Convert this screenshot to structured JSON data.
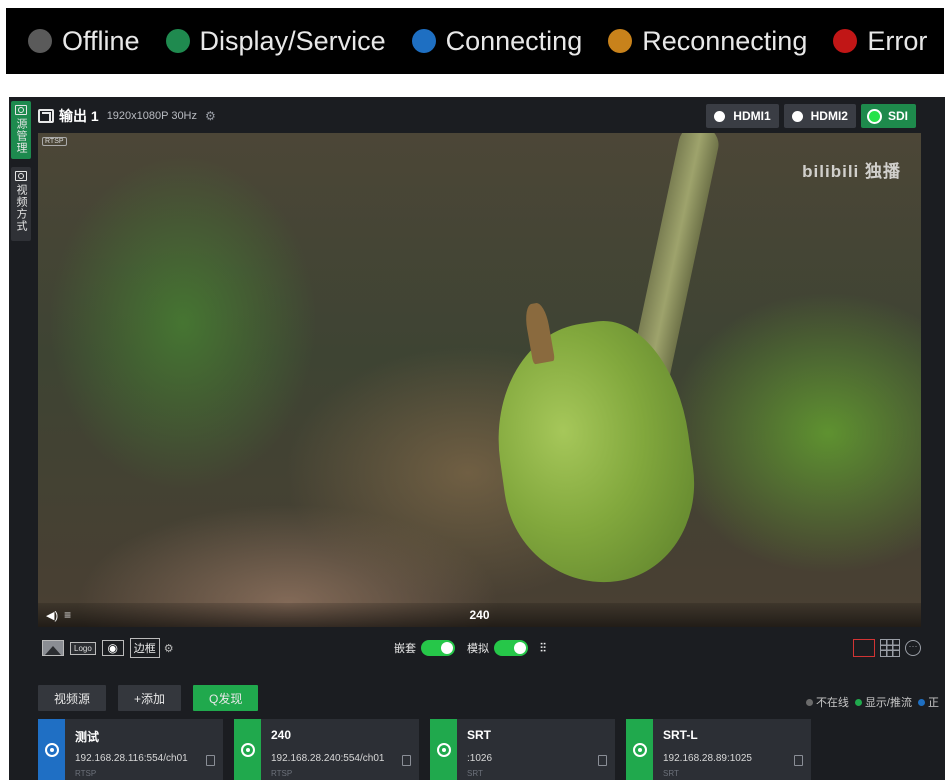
{
  "legend": [
    {
      "label": "Offline",
      "color": "#5a5a5a"
    },
    {
      "label": "Display/Service",
      "color": "#1f8a4f"
    },
    {
      "label": "Connecting",
      "color": "#1e6fc2"
    },
    {
      "label": "Reconnecting",
      "color": "#c8821b"
    },
    {
      "label": "Error",
      "color": "#c11616"
    }
  ],
  "side_tabs": [
    "源管理",
    "视频方式"
  ],
  "output": {
    "title": "输出 1",
    "resolution": "1920x1080P 30Hz",
    "ports": [
      {
        "label": "HDMI1",
        "active": false
      },
      {
        "label": "HDMI2",
        "active": false
      },
      {
        "label": "SDI",
        "active": true
      }
    ]
  },
  "video": {
    "tag": "RTSP",
    "watermark": "bilibili 独播",
    "label": "240"
  },
  "toolbar": {
    "logo_label": "Logo",
    "border_label": "边框",
    "embed_label": "嵌套",
    "analog_label": "模拟"
  },
  "source_buttons": {
    "source": "视频源",
    "add": "+添加",
    "discover": "Q发现"
  },
  "status_legend": [
    {
      "label": "不在线",
      "color": "#6b6b6b"
    },
    {
      "label": "显示/推流",
      "color": "#20a94d"
    },
    {
      "label": "正",
      "color": "#1e6fc2"
    }
  ],
  "sources": [
    {
      "name": "测试",
      "address": "192.168.28.116:554/ch01",
      "protocol": "RTSP",
      "status_color": "#1f6fc4"
    },
    {
      "name": "240",
      "address": "192.168.28.240:554/ch01",
      "protocol": "RTSP",
      "status_color": "#20a94d"
    },
    {
      "name": "SRT",
      "address": ":1026",
      "protocol": "SRT",
      "status_color": "#20a94d"
    },
    {
      "name": "SRT-L",
      "address": "192.168.28.89:1025",
      "protocol": "SRT",
      "status_color": "#20a94d"
    }
  ]
}
